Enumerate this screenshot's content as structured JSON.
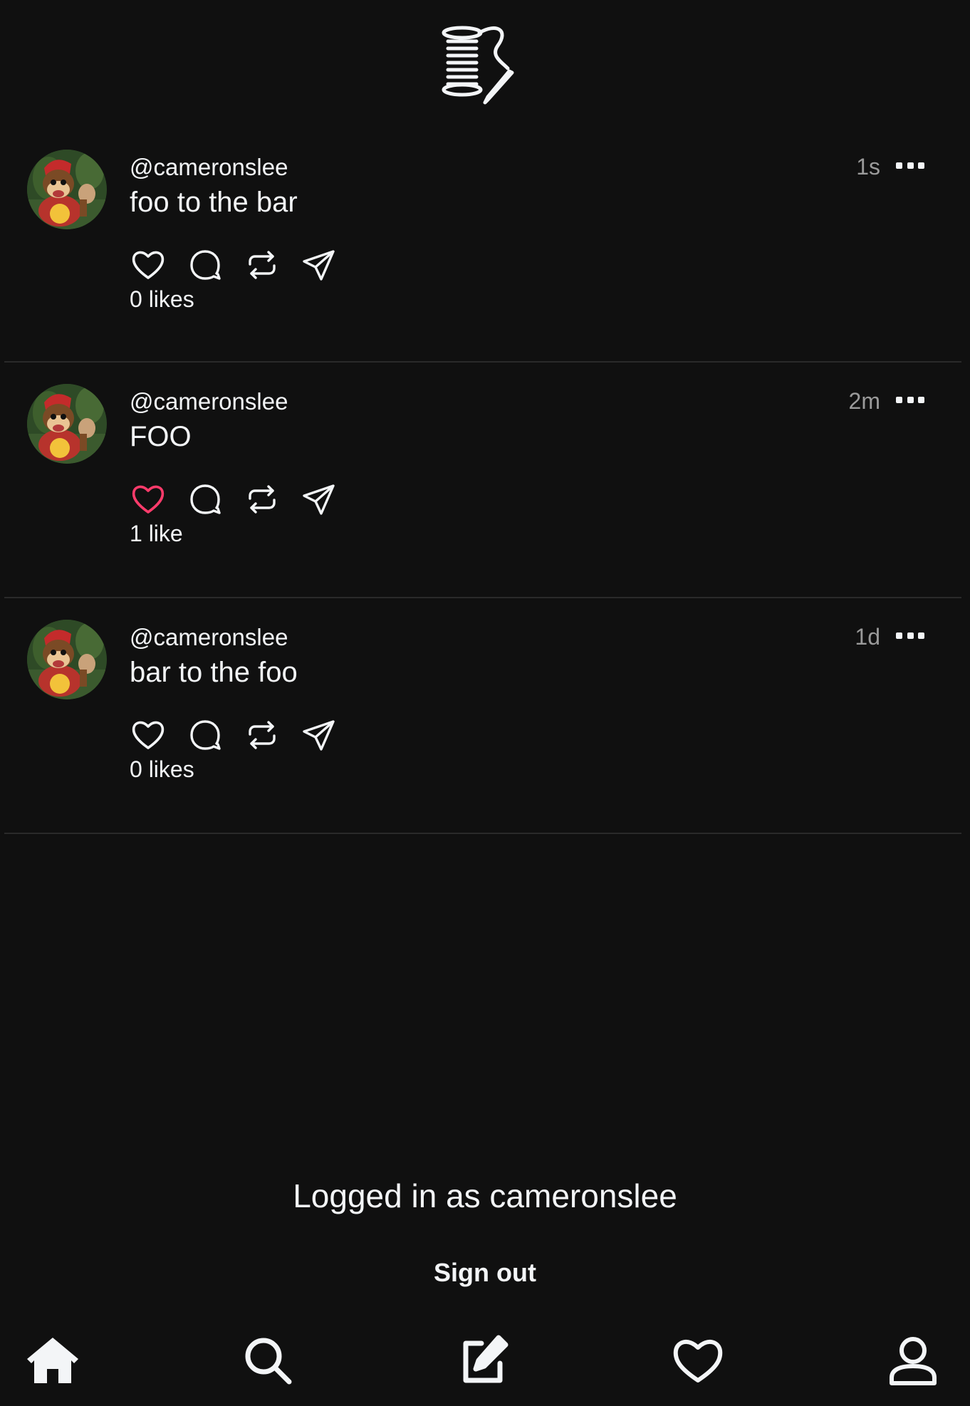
{
  "header": {
    "logo_icon": "thread-spool-icon"
  },
  "feed": {
    "posts": [
      {
        "username": "@cameronslee",
        "content": "foo to the bar",
        "time": "1s",
        "liked": false,
        "likes_text": "0 likes"
      },
      {
        "username": "@cameronslee",
        "content": "FOO",
        "time": "2m",
        "liked": true,
        "likes_text": "1 like"
      },
      {
        "username": "@cameronslee",
        "content": "bar to the foo",
        "time": "1d",
        "liked": false,
        "likes_text": "0 likes"
      }
    ],
    "action_icons": [
      "heart-icon",
      "comment-icon",
      "repost-icon",
      "share-icon"
    ]
  },
  "footer": {
    "logged_in_text": "Logged in as cameronslee",
    "sign_out_label": "Sign out"
  },
  "nav": {
    "icons": [
      "home-icon",
      "search-icon",
      "compose-icon",
      "heart-icon",
      "profile-icon"
    ]
  },
  "colors": {
    "background": "#101010",
    "text": "#f3f5f7",
    "muted": "#9a9a9a",
    "liked": "#ff3b6b",
    "divider": "#2a2a2a"
  }
}
